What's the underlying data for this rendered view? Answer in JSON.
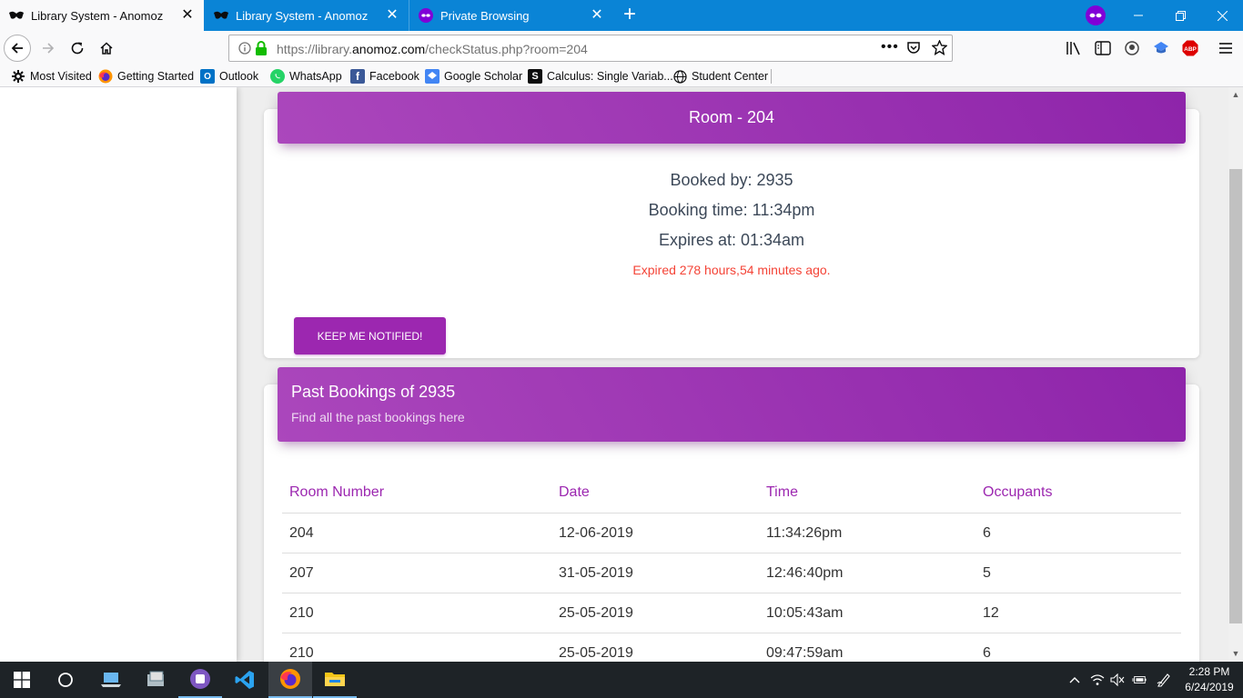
{
  "browser": {
    "tabs": [
      {
        "title": "Library System - Anomoz",
        "active": true
      },
      {
        "title": "Library System - Anomoz",
        "active": false
      },
      {
        "title": "Private Browsing",
        "active": false
      }
    ],
    "url_prefix": "https://library.",
    "url_domain": "anomoz.com",
    "url_path": "/checkStatus.php?room=204"
  },
  "bookmarks": [
    {
      "label": "Most Visited",
      "icon": "gear-icon"
    },
    {
      "label": "Getting Started",
      "icon": "firefox-icon"
    },
    {
      "label": "Outlook",
      "icon": "outlook-icon"
    },
    {
      "label": "WhatsApp",
      "icon": "whatsapp-icon"
    },
    {
      "label": "Facebook",
      "icon": "facebook-icon"
    },
    {
      "label": "Google Scholar",
      "icon": "scholar-icon"
    },
    {
      "label": "Calculus: Single Variab...",
      "icon": "s-icon"
    },
    {
      "label": "Student Center",
      "icon": "globe-icon"
    }
  ],
  "room_card": {
    "title": "Room - 204",
    "booked_by": "Booked by: 2935",
    "booking_time": "Booking time: 11:34pm",
    "expires_at": "Expires at: 01:34am",
    "expired_note": "Expired 278 hours,54 minutes ago.",
    "notify_button": "KEEP ME NOTIFIED!"
  },
  "past_bookings": {
    "title": "Past Bookings of 2935",
    "subtitle": "Find all the past bookings here",
    "columns": [
      "Room Number",
      "Date",
      "Time",
      "Occupants"
    ],
    "rows": [
      [
        "204",
        "12-06-2019",
        "11:34:26pm",
        "6"
      ],
      [
        "207",
        "31-05-2019",
        "12:46:40pm",
        "5"
      ],
      [
        "210",
        "25-05-2019",
        "10:05:43am",
        "12"
      ],
      [
        "210",
        "25-05-2019",
        "09:47:59am",
        "6"
      ]
    ]
  },
  "taskbar": {
    "time": "2:28 PM",
    "date": "6/24/2019"
  },
  "colors": {
    "browser_blue": "#0a84d6",
    "accent_purple": "#9c27b0",
    "expired_red": "#f44336"
  }
}
